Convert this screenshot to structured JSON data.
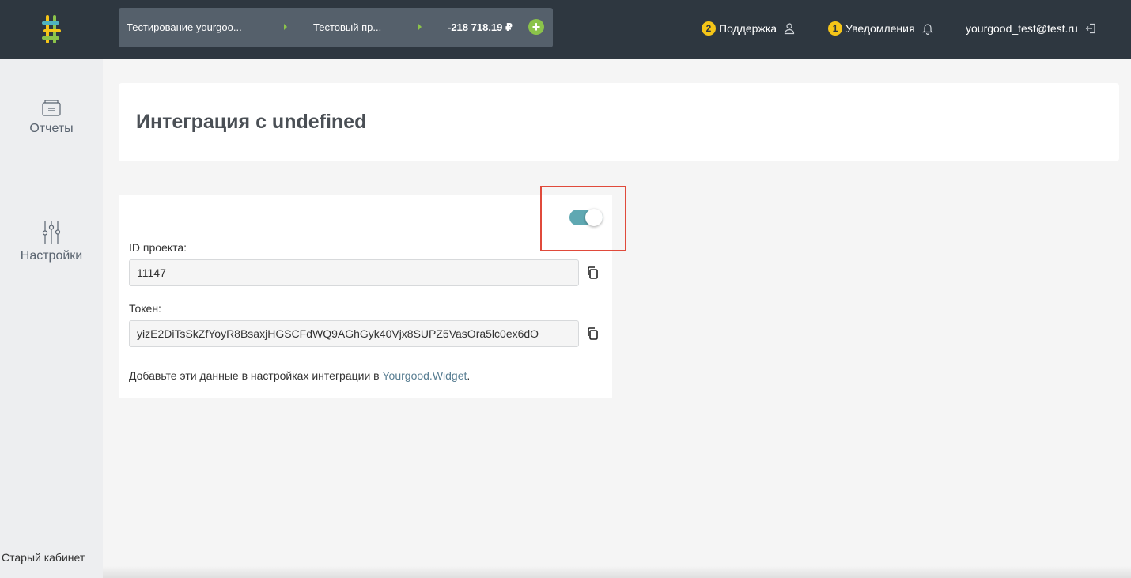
{
  "header": {
    "breadcrumb": {
      "org": "Тестирование yourgoo...",
      "project": "Тестовый пр...",
      "balance": "-218 718.19 ₽"
    },
    "support": {
      "count": "2",
      "label": "Поддержка"
    },
    "notifications": {
      "count": "1",
      "label": "Уведомления"
    },
    "user_email": "yourgood_test@test.ru"
  },
  "sidebar": {
    "reports_label": "Отчеты",
    "settings_label": "Настройки",
    "old_cabinet_label": "Старый кабинет"
  },
  "page": {
    "title": "Интеграция с undefined"
  },
  "form": {
    "toggle_on": true,
    "project_id_label": "ID проекта:",
    "project_id_value": "11147",
    "token_label": "Токен:",
    "token_value": "yizE2DiTsSkZfYoyR8BsaxjHGSCFdWQ9AGhGyk40Vjx8SUPZ5VasOra5lc0ex6dO",
    "hint_text": "Добавьте эти данные в настройках интеграции в ",
    "hint_link": "Yourgood.Widget",
    "hint_tail": "."
  },
  "colors": {
    "topbar": "#2e3740",
    "accent_green": "#8bc34a",
    "toggle": "#5fa8b2",
    "badge": "#f5c518",
    "highlight": "#e04a3b"
  }
}
